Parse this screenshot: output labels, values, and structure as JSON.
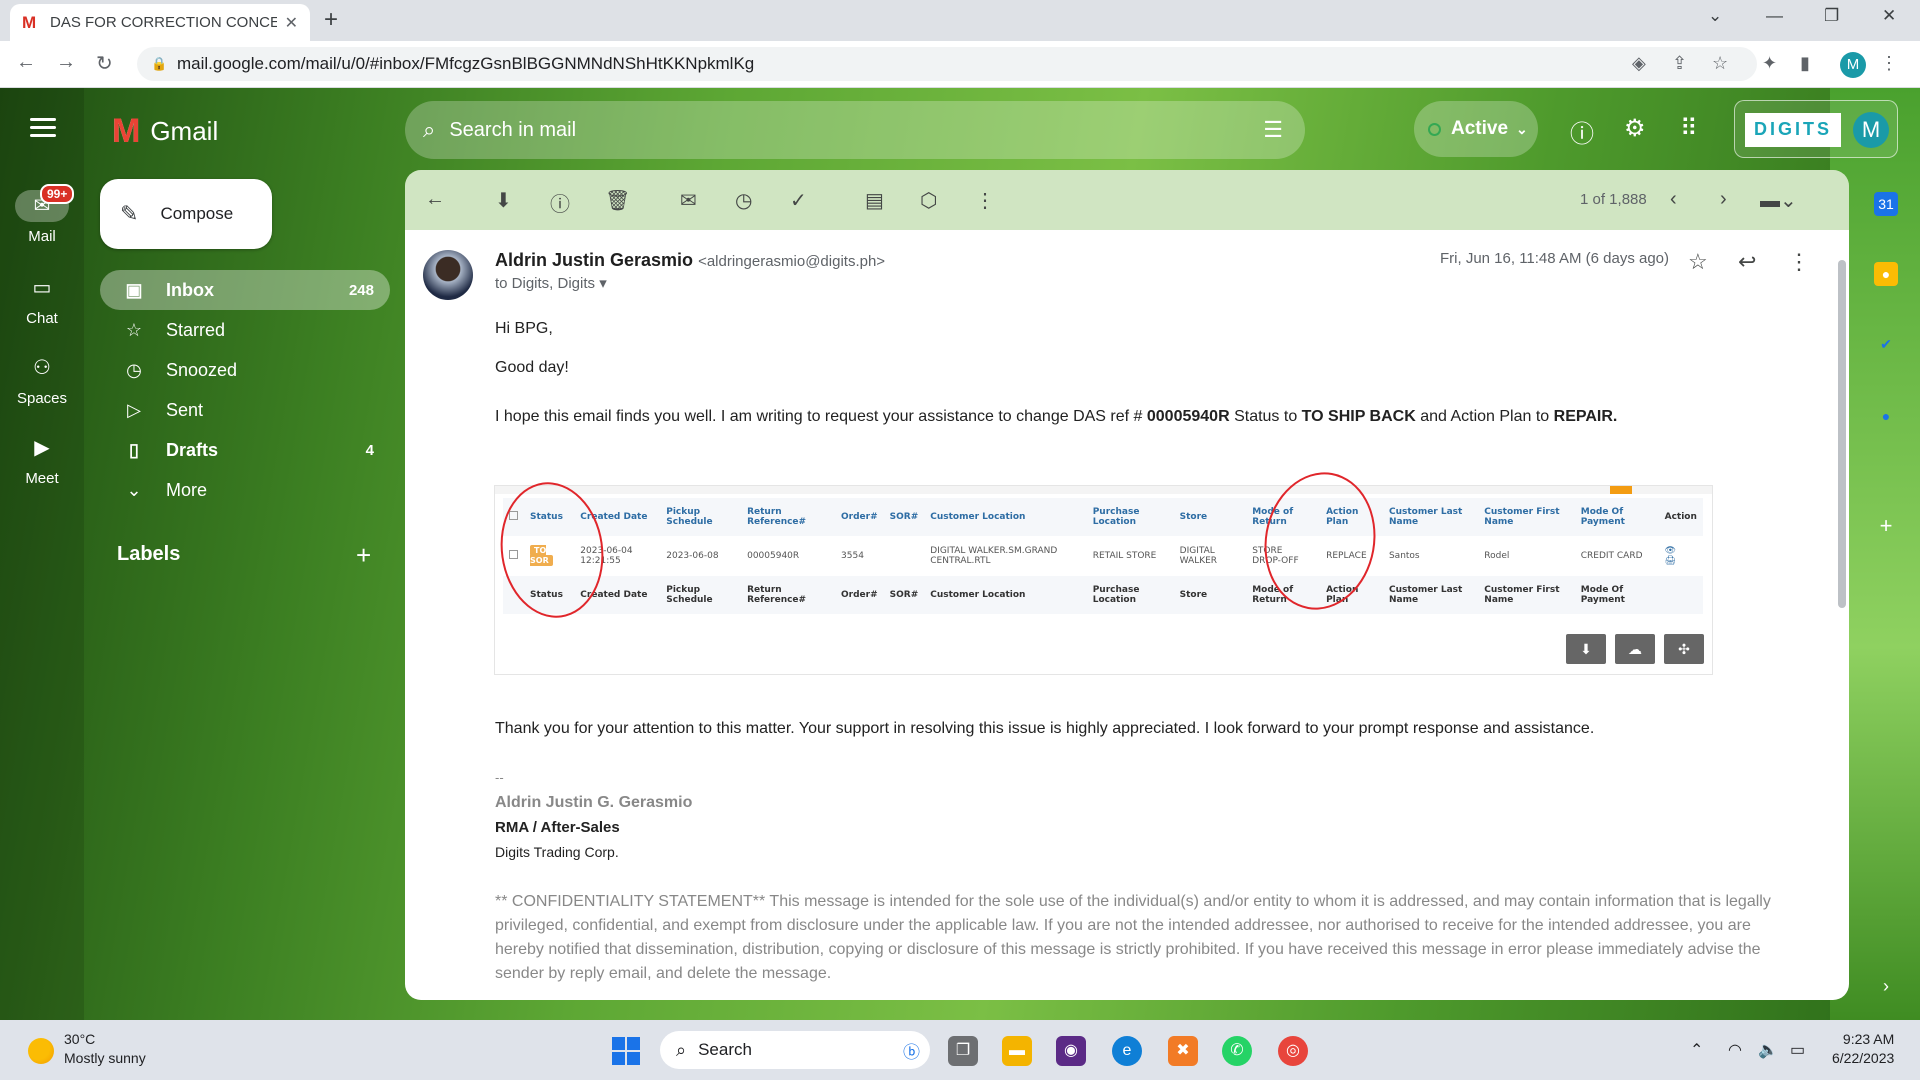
{
  "browser": {
    "tab_title": "DAS FOR CORRECTION CONCER",
    "url": "mail.google.com/mail/u/0/#inbox/FMfcgzGsnBlBGGNMNdNShHtKKNpkmlKg",
    "profile_initial": "M"
  },
  "rail": {
    "mail_label": "Mail",
    "mail_badge": "99+",
    "chat_label": "Chat",
    "spaces_label": "Spaces",
    "meet_label": "Meet"
  },
  "brand": "Gmail",
  "compose_label": "Compose",
  "nav": [
    {
      "label": "Inbox",
      "count": "248"
    },
    {
      "label": "Starred",
      "count": ""
    },
    {
      "label": "Snoozed",
      "count": ""
    },
    {
      "label": "Sent",
      "count": ""
    },
    {
      "label": "Drafts",
      "count": "4"
    },
    {
      "label": "More",
      "count": ""
    }
  ],
  "labels_heading": "Labels",
  "search": {
    "placeholder": "Search in mail"
  },
  "status": {
    "label": "Active"
  },
  "account": {
    "logo_text": "DIGITS",
    "initial": "M"
  },
  "toolbar": {
    "pager": "1 of 1,888"
  },
  "message": {
    "sender_name": "Aldrin Justin Gerasmio",
    "sender_email": "<aldringerasmio@digits.ph>",
    "to": "to Digits, Digits",
    "date": "Fri, Jun 16, 11:48 AM (6 days ago)",
    "greeting": "Hi BPG,",
    "good_day": "Good day!",
    "line1_a": "I hope this email finds you well. I am writing to request your assistance to change DAS ref # ",
    "line1_ref": "00005940R",
    "line1_b": " Status to ",
    "line1_status": "TO SHIP BACK",
    "line1_c": " and Action Plan to ",
    "line1_plan": "REPAIR.",
    "thanks": "Thank you for your attention to this matter. Your support in resolving this issue is highly appreciated. I look forward to your prompt response and assistance.",
    "sig_dash": "--",
    "sig_name": "Aldrin Justin G. Gerasmio",
    "sig_title": "RMA / After-Sales",
    "sig_company": "Digits Trading Corp.",
    "confidentiality": "** CONFIDENTIALITY STATEMENT** This message is intended for the sole use of the individual(s) and/or entity to whom it is addressed, and may contain information that is legally privileged, confidential, and exempt from disclosure under the applicable law. If you are not the intended addressee, nor authorised to receive for the intended addressee, you are hereby notified that dissemination, distribution, copying or disclosure of this message is strictly prohibited. If you have received this message in error please immediately advise the sender by reply email, and delete the message."
  },
  "embedded_table": {
    "headers": [
      "Status",
      "Created Date",
      "Pickup Schedule",
      "Return Reference#",
      "Order#",
      "SOR#",
      "Customer Location",
      "Purchase Location",
      "Store",
      "Mode of Return",
      "Action Plan",
      "Customer Last Name",
      "Customer First Name",
      "Mode Of Payment",
      "Action"
    ],
    "row": {
      "status_tag": "TO SOR",
      "created": "2023-06-04 12:21:55",
      "pickup": "2023-06-08",
      "return_ref": "00005940R",
      "order": "3554",
      "sor": "",
      "customer_location": "DIGITAL WALKER.SM.GRAND CENTRAL.RTL",
      "purchase_location": "RETAIL STORE",
      "store": "DIGITAL WALKER",
      "mode_of_return": "STORE DROP-OFF",
      "action_plan": "REPLACE",
      "last_name": "Santos",
      "first_name": "Rodel",
      "payment": "CREDIT CARD"
    }
  },
  "taskbar": {
    "temp": "30°C",
    "weather": "Mostly sunny",
    "search_label": "Search",
    "time": "9:23 AM",
    "date": "6/22/2023"
  },
  "colors": {
    "accent_red": "#e0262b",
    "digits_teal": "#1aa5b8"
  }
}
